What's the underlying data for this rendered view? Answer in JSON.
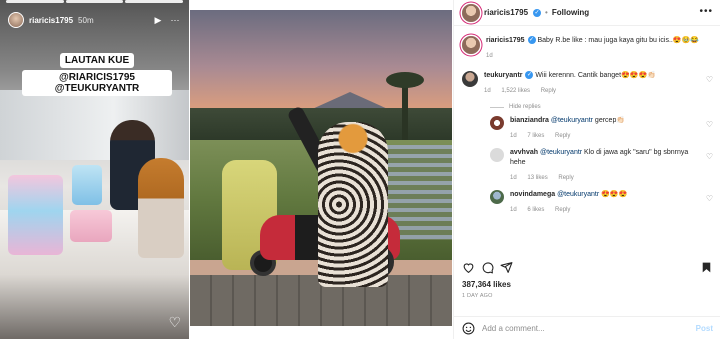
{
  "story": {
    "username": "riaricis1795",
    "time": "50m",
    "caption_lines": [
      "LAUTAN KUE",
      "@RIARICIS1795 @TEUKURYANTR"
    ],
    "progress_segments": 3
  },
  "post": {
    "author": "riaricis1795",
    "follow_label": "Following",
    "caption_user": "riaricis1795",
    "caption_text": "Baby R.be like : mau juga kaya gitu bu icis..😍🥹😂",
    "caption_time": "1d",
    "likes": "387,364 likes",
    "date": "1 DAY AGO",
    "add_comment_placeholder": "Add a comment...",
    "post_label": "Post"
  },
  "comments": [
    {
      "user": "teukuryantr",
      "verified": true,
      "text": "Wiii kerennn. Cantik banget😍😍😍👏🏻",
      "time": "1d",
      "likes": "1,522 likes",
      "reply": "Reply"
    }
  ],
  "hide_replies": "Hide replies",
  "replies": [
    {
      "user": "bianziandra",
      "mention": "@teukuryantr",
      "text": " gercep👏🏻",
      "time": "1d",
      "likes": "7 likes",
      "reply": "Reply"
    },
    {
      "user": "avvhvah",
      "mention": "@teukuryantr",
      "text": " Klo di jawa agk \"saru\" bg sbnrnya hehe",
      "time": "1d",
      "likes": "13 likes",
      "reply": "Reply"
    },
    {
      "user": "novindamega",
      "mention": "@teukuryantr",
      "text": " 😍😍😍",
      "time": "1d",
      "likes": "6 likes",
      "reply": "Reply"
    }
  ]
}
